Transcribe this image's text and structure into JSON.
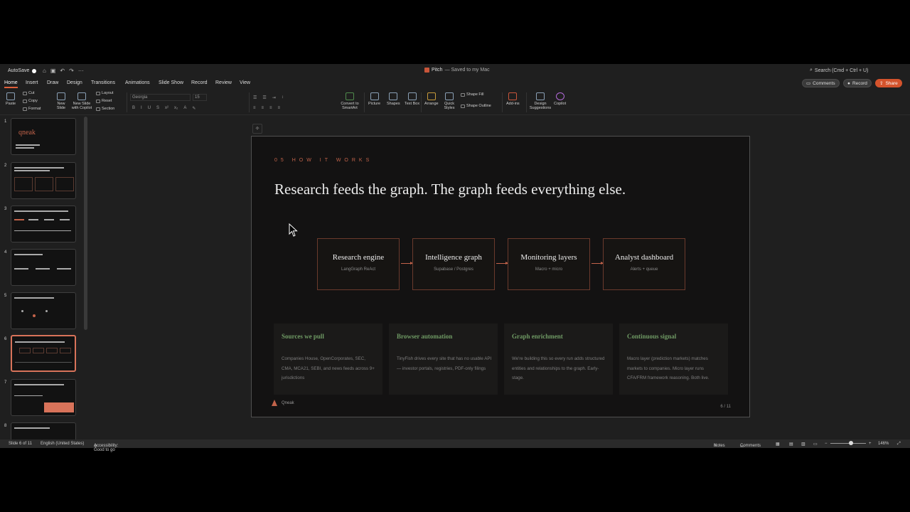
{
  "titlebar": {
    "autosave": "AutoSave",
    "doc_name": "Pitch",
    "doc_status": "— Saved to my Mac",
    "search_placeholder": "Search (Cmd + Ctrl + U)"
  },
  "tabs": [
    "Home",
    "Insert",
    "Draw",
    "Design",
    "Transitions",
    "Animations",
    "Slide Show",
    "Record",
    "Review",
    "View"
  ],
  "top_buttons": {
    "comments": "Comments",
    "record": "Record",
    "share": "Share"
  },
  "ribbon": {
    "paste": "Paste",
    "cut": "Cut",
    "copy": "Copy",
    "format": "Format",
    "new_slide": "New Slide",
    "new_slide_copilot": "New Slide with Copilot",
    "layout": "Layout",
    "reset": "Reset",
    "section": "Section",
    "font": "Georgia",
    "size": "15",
    "convert": "Convert to SmartArt",
    "picture": "Picture",
    "shapes": "Shapes",
    "textbox": "Text Box",
    "arrange": "Arrange",
    "quick_styles": "Quick Styles",
    "shape_fill": "Shape Fill",
    "shape_outline": "Shape Outline",
    "addins": "Add-ins",
    "design_suggestions": "Design Suggestions",
    "copilot": "Copilot"
  },
  "thumbnails": [
    {
      "num": "1"
    },
    {
      "num": "2"
    },
    {
      "num": "3"
    },
    {
      "num": "4"
    },
    {
      "num": "5"
    },
    {
      "num": "6"
    },
    {
      "num": "7"
    },
    {
      "num": "8"
    }
  ],
  "thumb1_logo": "qneak",
  "slide": {
    "eyebrow": "05   HOW IT WORKS",
    "headline": "Research feeds the graph. The graph feeds everything else.",
    "flow": [
      {
        "title": "Research engine",
        "sub": "LangGraph ReAct"
      },
      {
        "title": "Intelligence graph",
        "sub": "Supabase / Postgres"
      },
      {
        "title": "Monitoring layers",
        "sub": "Macro + micro"
      },
      {
        "title": "Analyst dashboard",
        "sub": "Alerts + queue"
      }
    ],
    "cards": [
      {
        "title": "Sources we pull",
        "body": "Companies House, OpenCorporates, SEC, CMA, MCA21, SEBI, and news feeds across 9+ jurisdictions"
      },
      {
        "title": "Browser automation",
        "body": "TinyFish drives every site that has no usable API — investor portals, registries, PDF-only filings"
      },
      {
        "title": "Graph enrichment",
        "body": "We're building this so every run adds structured entities and relationships to the graph. Early-stage."
      },
      {
        "title": "Continuous signal",
        "body": "Macro layer (prediction markets) matches markets to companies. Micro layer runs CFA/FRM framework reasoning. Both live."
      }
    ],
    "footer_logo": "Qneak",
    "page": "6 / 11"
  },
  "status": {
    "slide": "Slide 6 of 11",
    "language": "English (United States)",
    "accessibility": "Accessibility: Good to go",
    "notes": "Notes",
    "comments": "Comments",
    "zoom": "146%"
  },
  "colors": {
    "accent": "#c2634a",
    "card_title": "#6f9a64",
    "share": "#d4532c"
  }
}
